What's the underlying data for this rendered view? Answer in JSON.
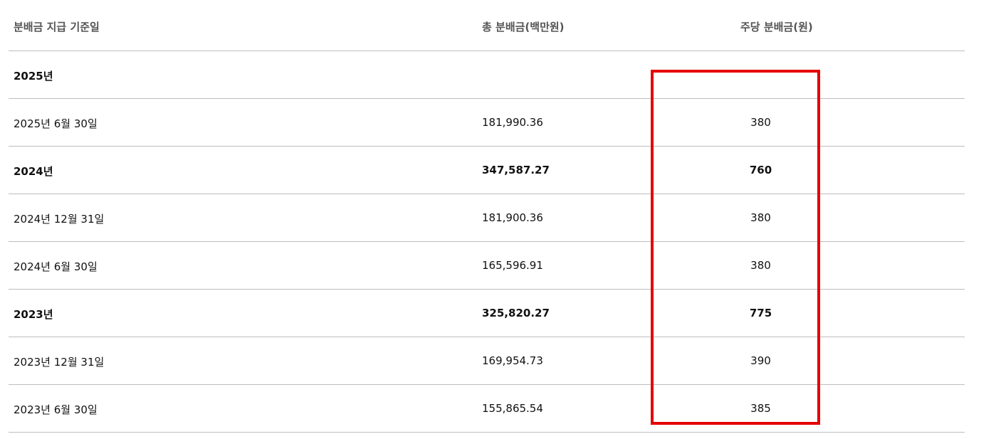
{
  "table": {
    "headers": [
      "분배금 지급 기준일",
      "총 분배금(백만원)",
      "주당 분배금(원)"
    ],
    "rows": [
      {
        "date": "2025년",
        "total": "",
        "per_share": "",
        "bold": true
      },
      {
        "date": "2025년 6월 30일",
        "total": "181,990.36",
        "per_share": "380",
        "bold": false
      },
      {
        "date": "2024년",
        "total": "347,587.27",
        "per_share": "760",
        "bold": true
      },
      {
        "date": "2024년 12월 31일",
        "total": "181,900.36",
        "per_share": "380",
        "bold": false
      },
      {
        "date": "2024년 6월 30일",
        "total": "165,596.91",
        "per_share": "380",
        "bold": false
      },
      {
        "date": "2023년",
        "total": "325,820.27",
        "per_share": "775",
        "bold": true
      },
      {
        "date": "2023년 12월 31일",
        "total": "169,954.73",
        "per_share": "390",
        "bold": false
      },
      {
        "date": "2023년 6월 30일",
        "total": "155,865.54",
        "per_share": "385",
        "bold": false
      }
    ]
  },
  "highlight": {
    "color": "#e60000"
  }
}
